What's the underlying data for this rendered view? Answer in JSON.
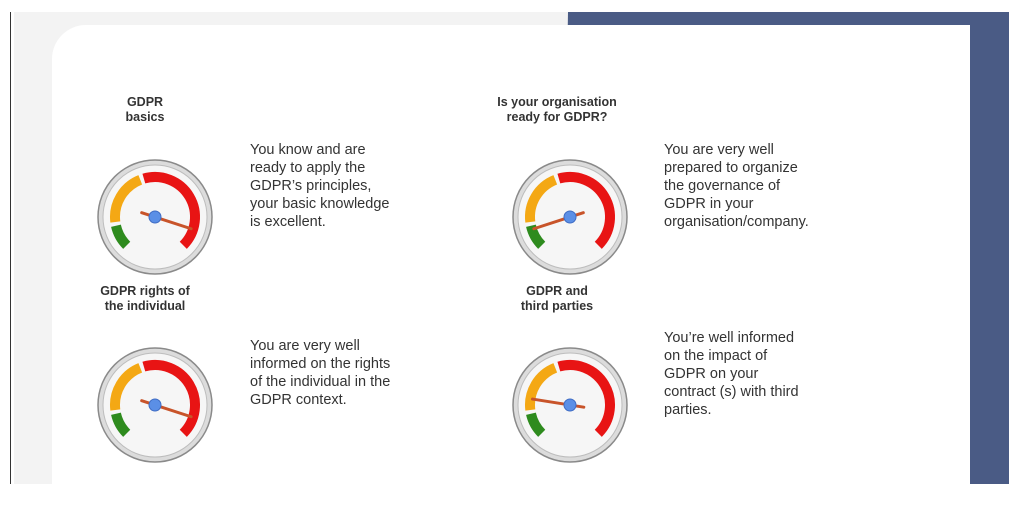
{
  "sections": [
    {
      "title_line1": "GDPR",
      "title_line2": "basics",
      "description": [
        "You know and are",
        "ready to apply the",
        "GDPR’s principles,",
        "your basic knowledge",
        "is excellent."
      ],
      "gauge_level": 0.9
    },
    {
      "title_line1": "Is your organisation",
      "title_line2": "ready for GDPR?",
      "description": [
        "You are very well",
        "prepared to organize",
        "the governance of",
        "GDPR in your",
        "organisation/company."
      ],
      "gauge_level": 0.1
    },
    {
      "title_line1": "GDPR rights of",
      "title_line2": "the individual",
      "description": [
        "You are very well",
        "informed on the rights",
        "of the individual in the",
        "GDPR context."
      ],
      "gauge_level": 0.9
    },
    {
      "title_line1": "GDPR and",
      "title_line2": "third parties",
      "description": [
        "You’re well informed",
        "on the impact of",
        "GDPR on your",
        "contract (s) with third",
        "parties."
      ],
      "gauge_level": 0.2
    }
  ],
  "colors": {
    "navy": "#4a5b85",
    "gauge_green": "#2e8b1e",
    "gauge_yellow": "#f4a814",
    "gauge_red": "#e81414",
    "needle": "#c8542a",
    "hub": "#5b8fe6"
  }
}
